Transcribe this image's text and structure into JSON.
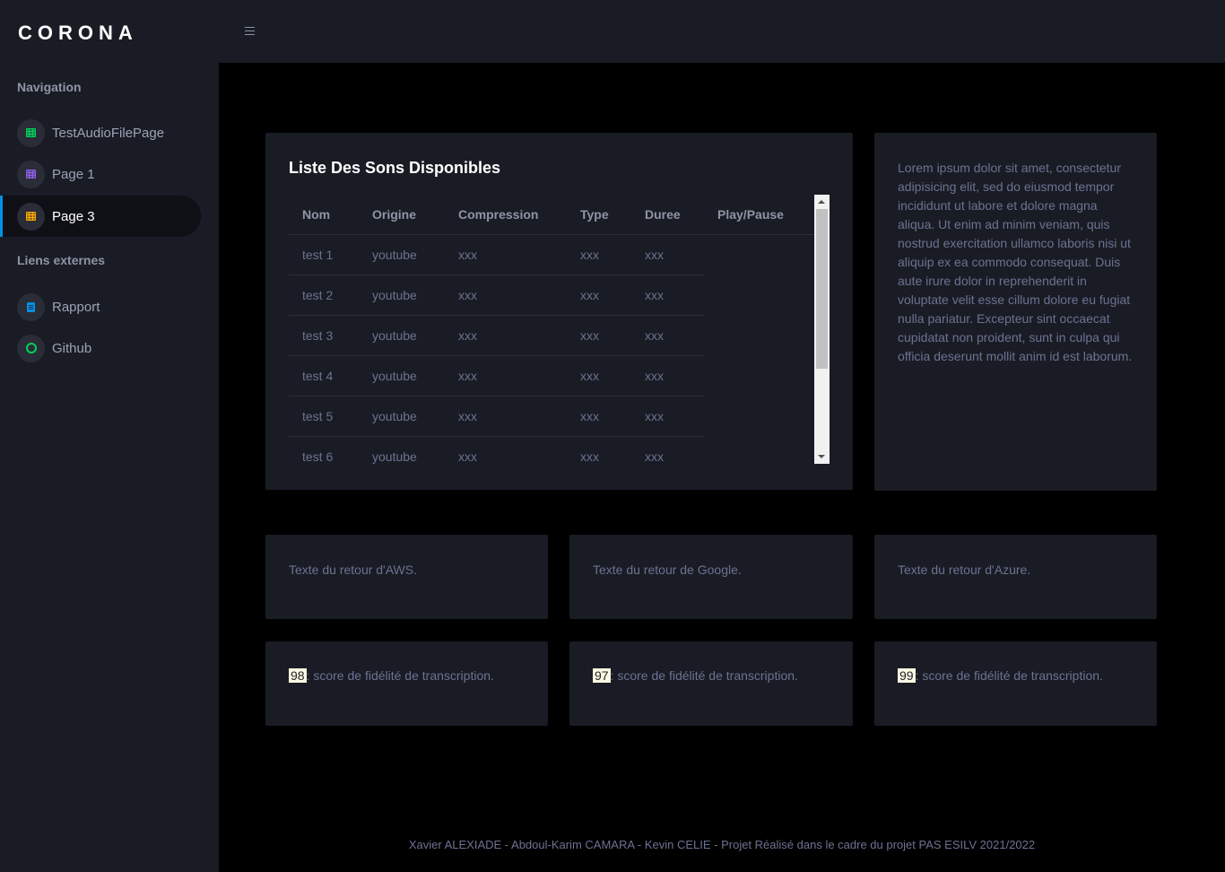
{
  "brand": "CORONA",
  "sidebar": {
    "nav_heading": "Navigation",
    "items": [
      {
        "label": "TestAudioFilePage",
        "icon": "table-icon",
        "color": "#00d25b"
      },
      {
        "label": "Page 1",
        "icon": "table-icon",
        "color": "#8f5fe8"
      },
      {
        "label": "Page 3",
        "icon": "table-icon",
        "color": "#ffab00",
        "active": true
      }
    ],
    "external_heading": "Liens externes",
    "external": [
      {
        "label": "Rapport",
        "icon": "document-icon",
        "color": "#0090e7"
      },
      {
        "label": "Github",
        "icon": "github-icon",
        "color": "#00d25b"
      }
    ]
  },
  "sounds_card": {
    "title": "Liste Des Sons Disponibles",
    "columns": [
      "Nom",
      "Origine",
      "Compression",
      "Type",
      "Duree",
      "Play/Pause"
    ],
    "rows": [
      [
        "test 1",
        "youtube",
        "xxx",
        "xxx",
        "xxx"
      ],
      [
        "test 2",
        "youtube",
        "xxx",
        "xxx",
        "xxx"
      ],
      [
        "test 3",
        "youtube",
        "xxx",
        "xxx",
        "xxx"
      ],
      [
        "test 4",
        "youtube",
        "xxx",
        "xxx",
        "xxx"
      ],
      [
        "test 5",
        "youtube",
        "xxx",
        "xxx",
        "xxx"
      ],
      [
        "test 6",
        "youtube",
        "xxx",
        "xxx",
        "xxx"
      ]
    ]
  },
  "description": "Lorem ipsum dolor sit amet, consectetur adipisicing elit, sed do eiusmod tempor incididunt ut labore et dolore magna aliqua. Ut enim ad minim veniam, quis nostrud exercitation ullamco laboris nisi ut aliquip ex ea commodo consequat. Duis aute irure dolor in reprehenderit in voluptate velit esse cillum dolore eu fugiat nulla pariatur. Excepteur sint occaecat cupidatat non proident, sunt in culpa qui officia deserunt mollit anim id est laborum.",
  "results": [
    {
      "text": "Texte du retour d'AWS.",
      "score": "98",
      "score_text": ": score de fidélité de transcription."
    },
    {
      "text": "Texte du retour de Google.",
      "score": "97",
      "score_text": ": score de fidélité de transcription."
    },
    {
      "text": "Texte du retour d'Azure.",
      "score": "99",
      "score_text": ": score de fidélité de transcription."
    }
  ],
  "footer": "Xavier ALEXIADE - Abdoul-Karim CAMARA - Kevin CELIE - Projet Réalisé dans le cadre du projet PAS ESILV 2021/2022"
}
